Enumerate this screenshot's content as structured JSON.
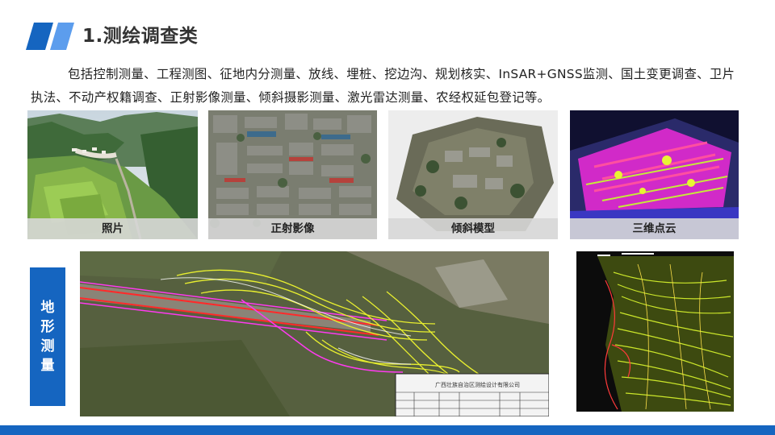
{
  "header": {
    "title": "1.测绘调查类"
  },
  "description": "包括控制测量、工程测图、征地内分测量、放线、埋桩、挖边沟、规划核实、InSAR+GNSS监测、国土变更调查、卫片执法、不动产权籍调查、正射影像测量、倾斜摄影测量、激光雷达测量、农经权延包登记等。",
  "cards": [
    {
      "caption": "照片"
    },
    {
      "caption": "正射影像"
    },
    {
      "caption": "倾斜模型"
    },
    {
      "caption": "三维点云"
    }
  ],
  "topography": {
    "label_chars": [
      "地",
      "形",
      "测",
      "量"
    ]
  },
  "map_large": {
    "company": "广西壮族自治区测绘设计有限公司"
  },
  "colors": {
    "accent": "#1565c0",
    "caption_bg": "#d7d7d7",
    "title_text": "#333333"
  }
}
